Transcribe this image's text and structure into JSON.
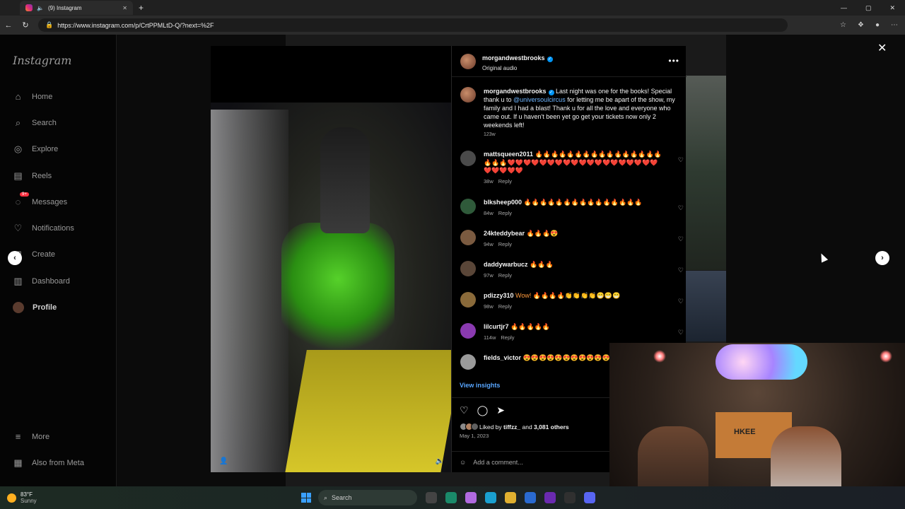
{
  "browser": {
    "tab_title": "(9) Instagram",
    "tab_close": "✕",
    "new_tab": "+",
    "url": "https://www.instagram.com/p/CrtPPMLtD-Q/?next=%2F",
    "window_controls": [
      "—",
      "▢",
      "✕"
    ]
  },
  "sidebar": {
    "logo": "Instagram",
    "items": [
      {
        "label": "Home",
        "icon": "home-icon",
        "glyph": "⌂"
      },
      {
        "label": "Search",
        "icon": "search-icon",
        "glyph": "⌕"
      },
      {
        "label": "Explore",
        "icon": "explore-icon",
        "glyph": "◎"
      },
      {
        "label": "Reels",
        "icon": "reels-icon",
        "glyph": "▤"
      },
      {
        "label": "Messages",
        "icon": "messages-icon",
        "glyph": "◌",
        "badge": "9+"
      },
      {
        "label": "Notifications",
        "icon": "heart-icon",
        "glyph": "♡"
      },
      {
        "label": "Create",
        "icon": "create-icon",
        "glyph": "⊞"
      },
      {
        "label": "Dashboard",
        "icon": "dashboard-icon",
        "glyph": "▥"
      },
      {
        "label": "Profile",
        "icon": "avatar",
        "glyph": ""
      }
    ],
    "more": "More",
    "meta": "Also from Meta"
  },
  "post": {
    "author": "morgandwestbrooks",
    "audio": "Original audio",
    "caption_pre": "Last night was one for the books! Special thank u to ",
    "caption_mention": "@universoulcircus",
    "caption_post": " for letting me be apart of the show, my family and I had a blast! Thank u for all the love and everyone who came out. If u haven't been yet go get your tickets now only 2 weekends left!",
    "caption_age": "123w",
    "view_insights": "View insights",
    "liked_by_pre": "Liked by ",
    "liked_by_user": "tiffzz_",
    "liked_by_mid": " and ",
    "liked_by_count": "3,081 others",
    "date": "May 1, 2023",
    "add_comment": "Add a comment..."
  },
  "comments": [
    {
      "user": "mattsqueen2011",
      "text": "🔥🔥🔥🔥🔥🔥🔥🔥🔥🔥🔥🔥🔥🔥🔥🔥🔥🔥🔥❤️❤️❤️❤️❤️❤️❤️❤️❤️❤️❤️❤️❤️❤️❤️❤️❤️❤️❤️❤️❤️❤️❤️❤️",
      "age": "38w",
      "reply": "Reply",
      "avatar_color": "#4a4a4a"
    },
    {
      "user": "blksheep000",
      "text": "🔥🔥🔥🔥🔥🔥🔥🔥🔥🔥🔥🔥🔥🔥🔥",
      "age": "84w",
      "reply": "Reply",
      "avatar_color": "#2f5a3a"
    },
    {
      "user": "24kteddybear",
      "text": "🔥🔥🔥😍",
      "age": "94w",
      "reply": "Reply",
      "avatar_color": "#7a5a40"
    },
    {
      "user": "daddywarbucz",
      "text": "🔥🔥🔥",
      "age": "97w",
      "reply": "Reply",
      "avatar_color": "#5a4638"
    },
    {
      "user": "pdizzy310",
      "text": "Wow! 🔥🔥🔥🔥👏👏👏👏😁😁😁",
      "age": "98w",
      "reply": "Reply",
      "avatar_color": "#8a6a3a"
    },
    {
      "user": "lilcurtjr7",
      "text": "🔥🔥🔥🔥🔥",
      "age": "114w",
      "reply": "Reply",
      "avatar_color": "#8a3ab0"
    },
    {
      "user": "fields_victor",
      "text": "😍😍😍😍😍😍😍😍😍😍😍😍",
      "age": "",
      "reply": "",
      "avatar_color": "#9a9a9a"
    }
  ],
  "taskbar": {
    "temperature": "83°F",
    "condition": "Sunny",
    "search": "Search"
  },
  "webcam": {
    "box_text": "HKEE"
  },
  "colors": {
    "link": "#6fb6ff",
    "insights": "#58a6ff",
    "verified": "#0095f6",
    "bike_green": "#56d12a"
  }
}
